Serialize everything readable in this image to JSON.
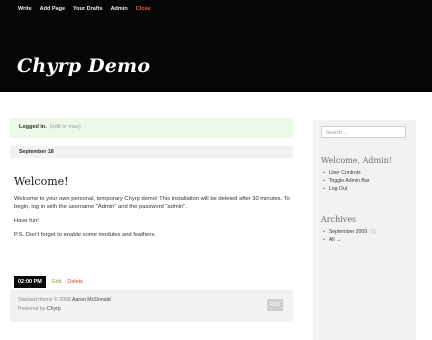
{
  "admin_bar": {
    "items": [
      "Write",
      "Add Page",
      "Your Drafts",
      "Admin",
      "Close"
    ]
  },
  "header": {
    "title": "Chyrp Demo"
  },
  "status": {
    "label": "Logged in.",
    "sub": "(edit or mas)"
  },
  "post": {
    "date": "September 18",
    "title": "Welcome!",
    "paragraphs": [
      "Welcome to your own personal, temporary Chyrp demo! This installation will be deleted after 30 minutes. To begin, log in with the username \"Admin\" and the password \"admin\".",
      "Have fun!",
      "P.S. Don't forget to enable some modules and feathers."
    ],
    "time": "02:00 PM",
    "edit": "Edit",
    "delete": "Delete"
  },
  "footer": {
    "line1_prefix": "Stacked theme © 2008",
    "line1_author": "Aaron McDonald",
    "line2_prefix": "Powered by",
    "line2_app": "Chyrp",
    "button": "RSS"
  },
  "sidebar": {
    "search_placeholder": "Search ...",
    "welcome_heading": "Welcome, Admin!",
    "welcome_links": [
      "User Controls",
      "Toggle Admin Bar",
      "Log Out"
    ],
    "archives_heading": "Archives",
    "archives": [
      {
        "label": "September 2009",
        "count": "(1)"
      },
      {
        "label": "All →",
        "count": ""
      }
    ]
  }
}
